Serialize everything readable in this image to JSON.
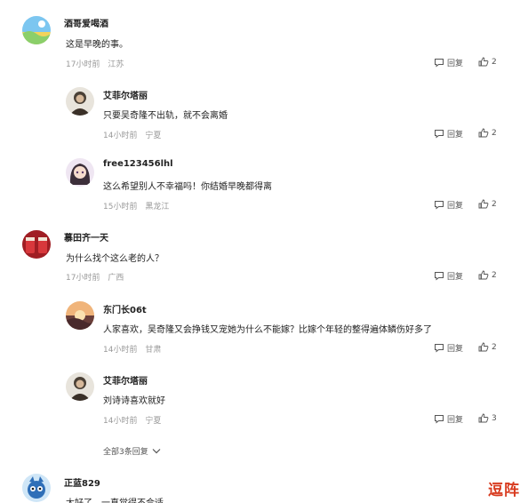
{
  "comments": [
    {
      "username": "酒哥爱喝酒",
      "text": "这是早晚的事。",
      "time": "17小时前",
      "location": "江苏",
      "reply_label": "回复",
      "likes": "2"
    },
    {
      "username": "艾菲尔塔丽",
      "text": "只要吴奇隆不出轨，就不会离婚",
      "time": "14小时前",
      "location": "宁夏",
      "reply_label": "回复",
      "likes": "2"
    },
    {
      "username": "free123456lhl",
      "text": "这么希望别人不幸福吗！你结婚早晚都得离",
      "time": "15小时前",
      "location": "黑龙江",
      "reply_label": "回复",
      "likes": "2"
    },
    {
      "username": "慕田齐一天",
      "text": "为什么找个这么老的人？",
      "time": "17小时前",
      "location": "广西",
      "reply_label": "回复",
      "likes": "2"
    },
    {
      "username": "东门长06t",
      "text": "人家喜欢，吴奇隆又会挣钱又宠她为什么不能嫁？比嫁个年轻的整得遍体鳞伤好多了",
      "time": "14小时前",
      "location": "甘肃",
      "reply_label": "回复",
      "likes": "2"
    },
    {
      "username": "艾菲尔塔丽",
      "text": "刘诗诗喜欢就好",
      "time": "14小时前",
      "location": "宁夏",
      "reply_label": "回复",
      "likes": "3"
    },
    {
      "username": "正蓝829",
      "text": "太好了，一直觉得不合适"
    }
  ],
  "expand_replies": "全部3条回复",
  "watermark": "逗阵",
  "icons": {
    "reply": "speech-bubble-icon",
    "like": "thumbs-up-icon",
    "expand": "chevron-down-icon"
  },
  "colors": {
    "meta": "#999999",
    "watermark": "#d83b1f"
  }
}
